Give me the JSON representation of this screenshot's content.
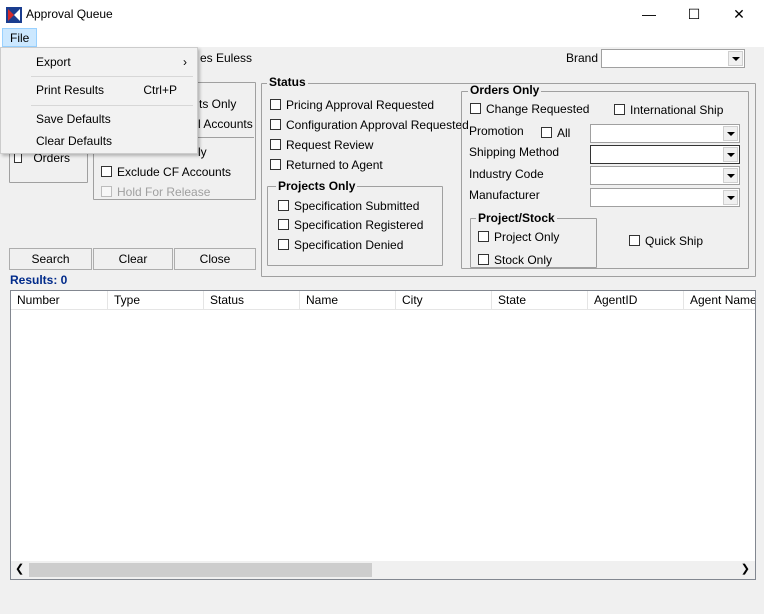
{
  "window": {
    "title": "Approval Queue",
    "minimize": "—",
    "maximize": "☐",
    "close": "✕"
  },
  "menubar": {
    "file": "File"
  },
  "file_menu": {
    "items": [
      {
        "label": "Export",
        "shortcut": "",
        "has_submenu": true
      },
      {
        "label": "Print Results",
        "shortcut": "Ctrl+P"
      },
      {
        "label": "Save Defaults",
        "shortcut": ""
      },
      {
        "label": "Clear Defaults",
        "shortcut": ""
      }
    ]
  },
  "top": {
    "location_text": "es Euless",
    "brand_label": "Brand",
    "brand_value": ""
  },
  "left_panel": {
    "partial_ts_only": "ts Only",
    "partial_accounts": "l Accounts",
    "partial_ly": "ly",
    "orders": "Orders",
    "exclude_cf": "Exclude CF Accounts",
    "hold_for_release": "Hold For Release"
  },
  "status_group": {
    "title": "Status",
    "items": [
      "Pricing Approval Requested",
      "Configuration Approval Requested",
      "Request Review",
      "Returned to Agent"
    ]
  },
  "projects_only": {
    "title": "Projects Only",
    "items": [
      "Specification Submitted",
      "Specification Registered",
      "Specification Denied"
    ]
  },
  "orders_only": {
    "title": "Orders Only",
    "change_requested": "Change Requested",
    "international_ship": "International Ship",
    "promotion_label": "Promotion",
    "all_label": "All",
    "shipping_method_label": "Shipping Method",
    "industry_code_label": "Industry Code",
    "manufacturer_label": "Manufacturer",
    "quick_ship": "Quick Ship"
  },
  "project_stock": {
    "title": "Project/Stock",
    "project_only": "Project Only",
    "stock_only": "Stock Only"
  },
  "buttons": {
    "search": "Search",
    "clear": "Clear",
    "close": "Close"
  },
  "results_label": "Results: 0",
  "grid": {
    "columns": [
      "Number",
      "Type",
      "Status",
      "Name",
      "City",
      "State",
      "AgentID",
      "Agent Name"
    ]
  }
}
